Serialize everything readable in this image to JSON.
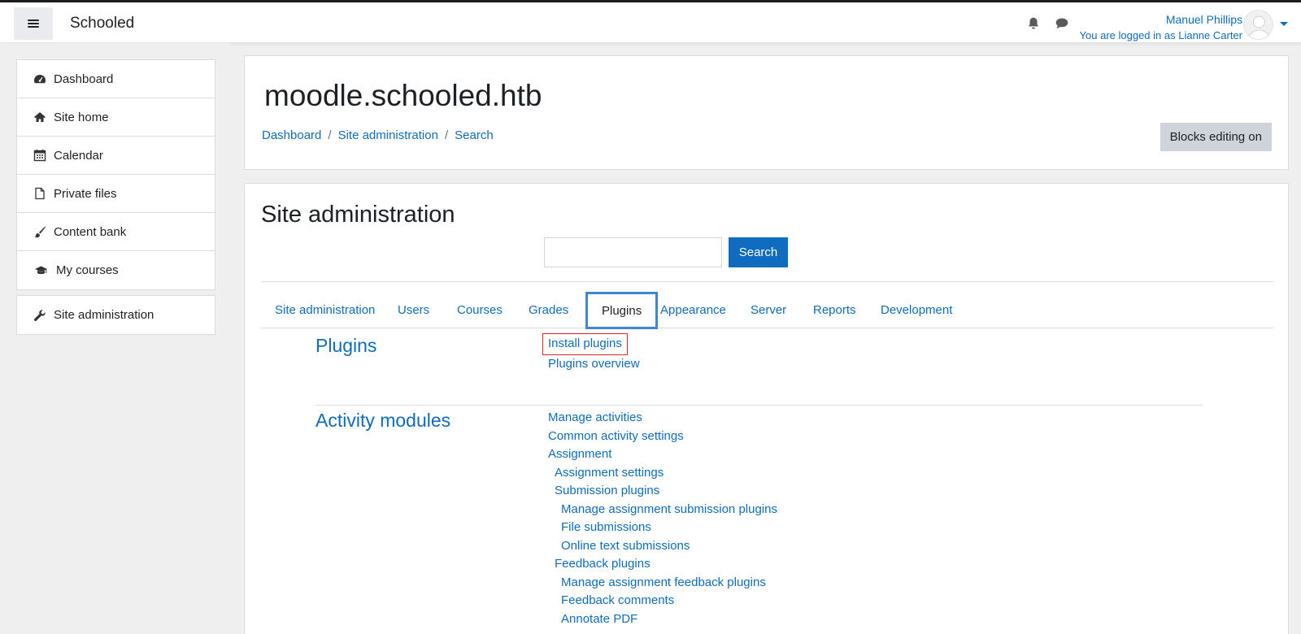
{
  "navbar": {
    "brand": "Schooled",
    "user_name": "Manuel Phillips",
    "logged_in_as": "You are logged in as Lianne Carter",
    "icons": [
      "menu-icon",
      "bell-icon",
      "chat-icon",
      "avatar",
      "caret-down-icon"
    ]
  },
  "sidebar": {
    "items": [
      {
        "label": "Dashboard",
        "icon": "dashboard-icon"
      },
      {
        "label": "Site home",
        "icon": "home-icon"
      },
      {
        "label": "Calendar",
        "icon": "calendar-icon"
      },
      {
        "label": "Private files",
        "icon": "file-icon"
      },
      {
        "label": "Content bank",
        "icon": "brush-icon"
      },
      {
        "label": "My courses",
        "icon": "graduation-cap-icon"
      }
    ],
    "admin_item": {
      "label": "Site administration",
      "icon": "wrench-icon"
    }
  },
  "header": {
    "site_title": "moodle.schooled.htb",
    "breadcrumb": [
      "Dashboard",
      "Site administration",
      "Search"
    ],
    "breadcrumb_separator": "/",
    "blocks_editing_button": "Blocks editing on"
  },
  "main": {
    "heading": "Site administration",
    "search": {
      "value": "",
      "placeholder": "",
      "button_label": "Search"
    },
    "tabs": [
      {
        "label": "Site administration",
        "active": false
      },
      {
        "label": "Users",
        "active": false
      },
      {
        "label": "Courses",
        "active": false
      },
      {
        "label": "Grades",
        "active": false
      },
      {
        "label": "Plugins",
        "active": true
      },
      {
        "label": "Appearance",
        "active": false
      },
      {
        "label": "Server",
        "active": false
      },
      {
        "label": "Reports",
        "active": false
      },
      {
        "label": "Development",
        "active": false
      }
    ],
    "sections": [
      {
        "title": "Plugins",
        "links": [
          {
            "label": "Install plugins",
            "level": 0,
            "highlighted": true
          },
          {
            "label": "Plugins overview",
            "level": 0
          }
        ]
      },
      {
        "title": "Activity modules",
        "links": [
          {
            "label": "Manage activities",
            "level": 0
          },
          {
            "label": "Common activity settings",
            "level": 0
          },
          {
            "label": "Assignment",
            "level": 0
          },
          {
            "label": "Assignment settings",
            "level": 1
          },
          {
            "label": "Submission plugins",
            "level": 1
          },
          {
            "label": "Manage assignment submission plugins",
            "level": 2
          },
          {
            "label": "File submissions",
            "level": 2
          },
          {
            "label": "Online text submissions",
            "level": 2
          },
          {
            "label": "Feedback plugins",
            "level": 1
          },
          {
            "label": "Manage assignment feedback plugins",
            "level": 2
          },
          {
            "label": "Feedback comments",
            "level": 2
          },
          {
            "label": "Annotate PDF",
            "level": 2
          }
        ]
      }
    ]
  },
  "colors": {
    "link": "#0f6cbf",
    "active_tab_border": "#3d87d6",
    "highlight_border": "#ee2222",
    "primary_button": "#0f6cbf"
  }
}
